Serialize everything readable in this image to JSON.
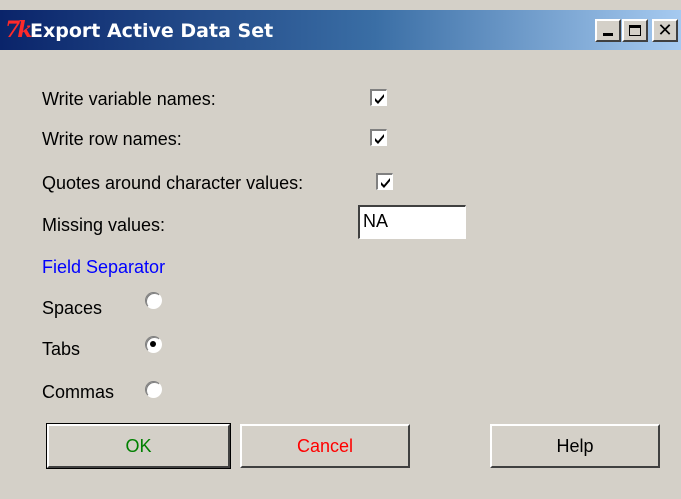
{
  "window": {
    "title": "Export Active Data Set",
    "icon": "tk-icon"
  },
  "options": {
    "write_variable_names": {
      "label": "Write variable names:",
      "checked": true
    },
    "write_row_names": {
      "label": "Write row names:",
      "checked": true
    },
    "quotes_around_character_values": {
      "label": "Quotes around character values:",
      "checked": true
    }
  },
  "missing_values": {
    "label": "Missing values:",
    "value": "NA"
  },
  "field_separator": {
    "heading": "Field Separator",
    "options": [
      {
        "label": "Spaces",
        "selected": false
      },
      {
        "label": "Tabs",
        "selected": true
      },
      {
        "label": "Commas",
        "selected": false
      }
    ]
  },
  "buttons": {
    "ok": "OK",
    "cancel": "Cancel",
    "help": "Help"
  },
  "colors": {
    "ok_text": "#008000",
    "cancel_text": "#ff0000",
    "heading_text": "#0000ff",
    "title_bar_start": "#0a246a",
    "title_bar_end": "#a6caf0"
  }
}
